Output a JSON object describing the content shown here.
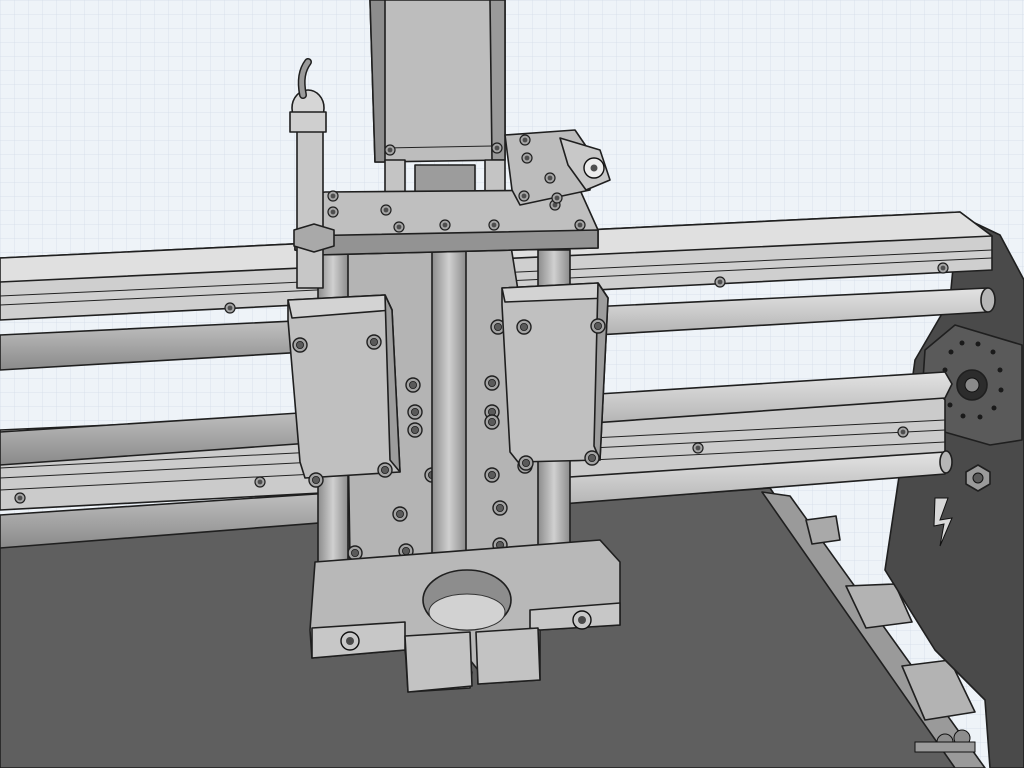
{
  "viewport": {
    "kind": "cad-3d-render",
    "subject": "cnc-gantry-z-axis-assembly",
    "background": "#eef3f8",
    "grid_color": "#c7d3e0",
    "colors": {
      "part_light": "#c9c9c9",
      "part_mid": "#a9a9a9",
      "part_dark": "#7d7d7d",
      "plate_dark": "#4a4a4a",
      "bed": "#5f5f5f",
      "outline": "#1f1f1f"
    }
  }
}
